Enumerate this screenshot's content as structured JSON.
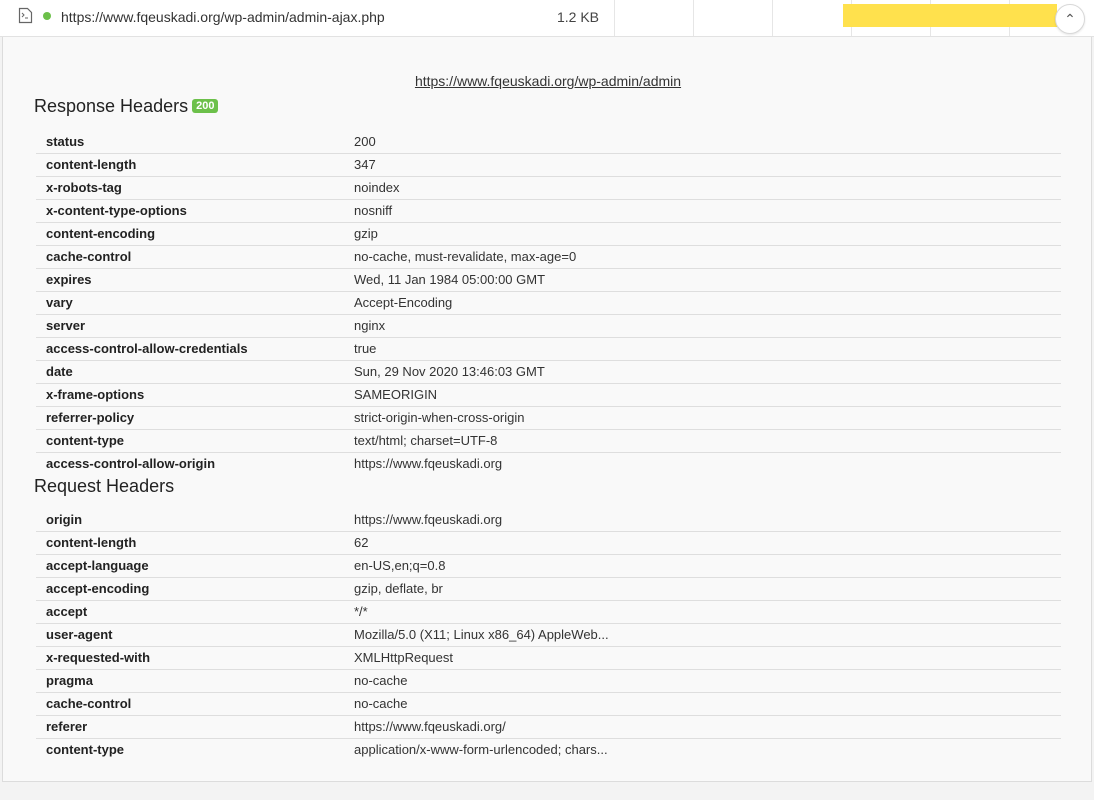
{
  "request": {
    "url": "https://www.fqeuskadi.org/wp-admin/admin-ajax.php",
    "size": "1.2 KB",
    "status_color": "#6cc04a",
    "bar_color": "#ffe14d",
    "collapse_icon": "chevron-up-icon",
    "collapse_glyph": "⌃"
  },
  "panel": {
    "link": "https://www.fqeuskadi.org/wp-admin/admin"
  },
  "response_headers": {
    "title": "Response Headers",
    "status_badge": "200",
    "rows": [
      {
        "name": "status",
        "value": "200"
      },
      {
        "name": "content-length",
        "value": "347"
      },
      {
        "name": "x-robots-tag",
        "value": "noindex"
      },
      {
        "name": "x-content-type-options",
        "value": "nosniff"
      },
      {
        "name": "content-encoding",
        "value": "gzip"
      },
      {
        "name": "cache-control",
        "value": "no-cache, must-revalidate, max-age=0"
      },
      {
        "name": "expires",
        "value": "Wed, 11 Jan 1984 05:00:00 GMT"
      },
      {
        "name": "vary",
        "value": "Accept-Encoding"
      },
      {
        "name": "server",
        "value": "nginx"
      },
      {
        "name": "access-control-allow-credentials",
        "value": "true"
      },
      {
        "name": "date",
        "value": "Sun, 29 Nov 2020 13:46:03 GMT"
      },
      {
        "name": "x-frame-options",
        "value": "SAMEORIGIN"
      },
      {
        "name": "referrer-policy",
        "value": "strict-origin-when-cross-origin"
      },
      {
        "name": "content-type",
        "value": "text/html; charset=UTF-8"
      },
      {
        "name": "access-control-allow-origin",
        "value": "https://www.fqeuskadi.org"
      }
    ]
  },
  "request_headers": {
    "title": "Request Headers",
    "rows": [
      {
        "name": "origin",
        "value": "https://www.fqeuskadi.org"
      },
      {
        "name": "content-length",
        "value": "62"
      },
      {
        "name": "accept-language",
        "value": "en-US,en;q=0.8"
      },
      {
        "name": "accept-encoding",
        "value": "gzip, deflate, br"
      },
      {
        "name": "accept",
        "value": "*/*"
      },
      {
        "name": "user-agent",
        "value": "Mozilla/5.0 (X11; Linux x86_64) AppleWeb..."
      },
      {
        "name": "x-requested-with",
        "value": "XMLHttpRequest"
      },
      {
        "name": "pragma",
        "value": "no-cache"
      },
      {
        "name": "cache-control",
        "value": "no-cache"
      },
      {
        "name": "referer",
        "value": "https://www.fqeuskadi.org/"
      },
      {
        "name": "content-type",
        "value": "application/x-www-form-urlencoded; chars..."
      }
    ]
  }
}
